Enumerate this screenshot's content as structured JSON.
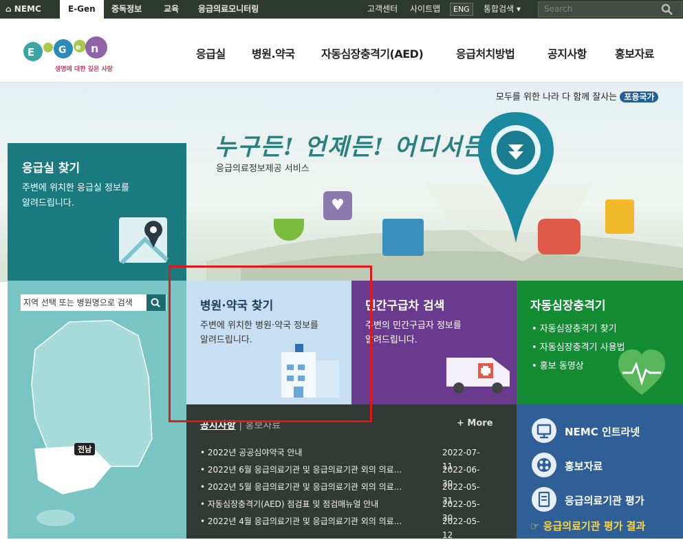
{
  "topbar": {
    "nemc": "NEMC",
    "egen": "E-Gen",
    "tab3": "중독정보",
    "tab4": "교육",
    "tab5": "응급의료모니터링",
    "help": "고객센터",
    "sitemap": "사이트맵",
    "eng": "ENG",
    "search_type": "통합검색",
    "search_placeholder": "Search"
  },
  "logo": {
    "text": "E-Gen",
    "tagline": "생명에 대한 깊은 사랑"
  },
  "nav": [
    "응급실",
    "병원.약국",
    "자동심장충격기(AED)",
    "응급처치방법",
    "공지사항",
    "홍보자료"
  ],
  "hero": {
    "slogan": "모두를 위한 나라 다 함께 잘사는",
    "slogan_badge": "포용국가",
    "headline": "누구든! 언제든! 어디서든!",
    "sub": "응급의료정보제공 서비스"
  },
  "er": {
    "title": "응급실 찾기",
    "desc1": "주변에 위치한 응급실 정보를",
    "desc2": "알려드립니다.",
    "search_placeholder": "지역 선택 또는 병원명으로 검색",
    "region": "전남"
  },
  "hospital": {
    "title": "병원·약국 찾기",
    "desc1": "주변에 위치한 병원·약국 정보를",
    "desc2": "알려드립니다."
  },
  "ambulance": {
    "title": "민간구급차 검색",
    "desc1": "주변의 민간구급자 정보를",
    "desc2": "알려드립니다."
  },
  "aed": {
    "title": "자동심장충격기",
    "items": [
      "• 자동심장충격기 찾기",
      "• 자동심장충격기 사용법",
      "• 홍보 동영상"
    ]
  },
  "notice": {
    "tab_active": "공지사항",
    "tab_other": "홍보자료",
    "more": "+ More",
    "rows": [
      {
        "title": "• 2022년 공공심야약국 안내",
        "date": "2022-07-11"
      },
      {
        "title": "• 2022년 6월 응급의료기관 및 응급의료기관 외의 의료...",
        "date": "2022-06-30"
      },
      {
        "title": "• 2022년 5월 응급의료기관 및 응급의료기관 외의 의료...",
        "date": "2022-05-31"
      },
      {
        "title": "• 자동심장충격기(AED) 점검표 및 점검매뉴얼 안내",
        "date": "2022-05-30"
      },
      {
        "title": "• 2022년 4월 응급의료기관 및 응급의료기관 외의 의료...",
        "date": "2022-05-12"
      }
    ]
  },
  "links": {
    "intranet": "NEMC 인트라넷",
    "pr": "홍보자료",
    "eval": "응급의료기관 평가",
    "eval_result": "☞ 응급의료기관 평가 결과"
  },
  "colors": {
    "topbar": "#2f3a2e",
    "teal": "#1a7a80",
    "purple": "#6a3a8e",
    "green": "#148c34",
    "blue": "#2e5f96",
    "highlight": "#e01818"
  }
}
